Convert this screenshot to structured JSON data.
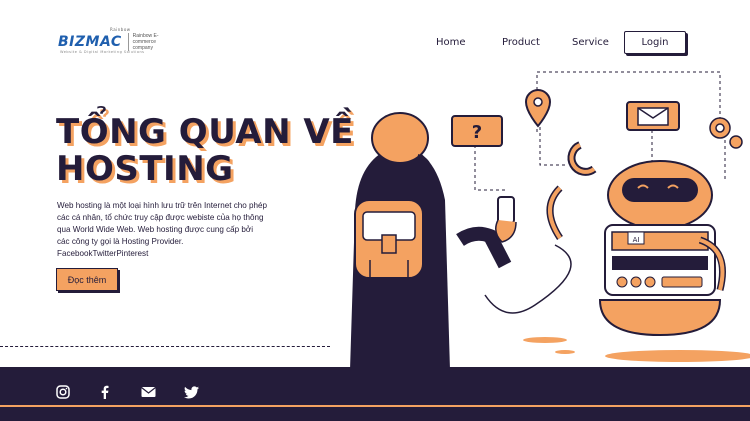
{
  "brand": {
    "logo_text": "BIZMAC",
    "logo_sup": "Rainbow",
    "logo_sub": "Website & Digital Marketing Solutions",
    "tagline": "Rainbow E-commerce company"
  },
  "nav": {
    "items": [
      "Home",
      "Product",
      "Service"
    ],
    "login_label": "Login"
  },
  "hero": {
    "title_line1": "TỔNG QUAN VỀ",
    "title_line2": "HOSTING",
    "description": "Web hosting là một loại hình lưu trữ trên Internet cho phép các cá nhân, tổ chức truy cập được webiste của họ thông qua World Wide Web. Web hosting được cung cấp bởi các công ty gọi là Hosting Provider.",
    "social_text": "FacebookTwitterPinterest",
    "cta_label": "Đọc thêm"
  },
  "illustration": {
    "question_mark": "?",
    "robot_label": "AI"
  },
  "footer": {
    "icons": [
      "instagram-icon",
      "facebook-icon",
      "mail-icon",
      "twitter-icon"
    ]
  },
  "colors": {
    "accent": "#f4a261",
    "dark": "#241c3a",
    "background": "#ffffff"
  }
}
